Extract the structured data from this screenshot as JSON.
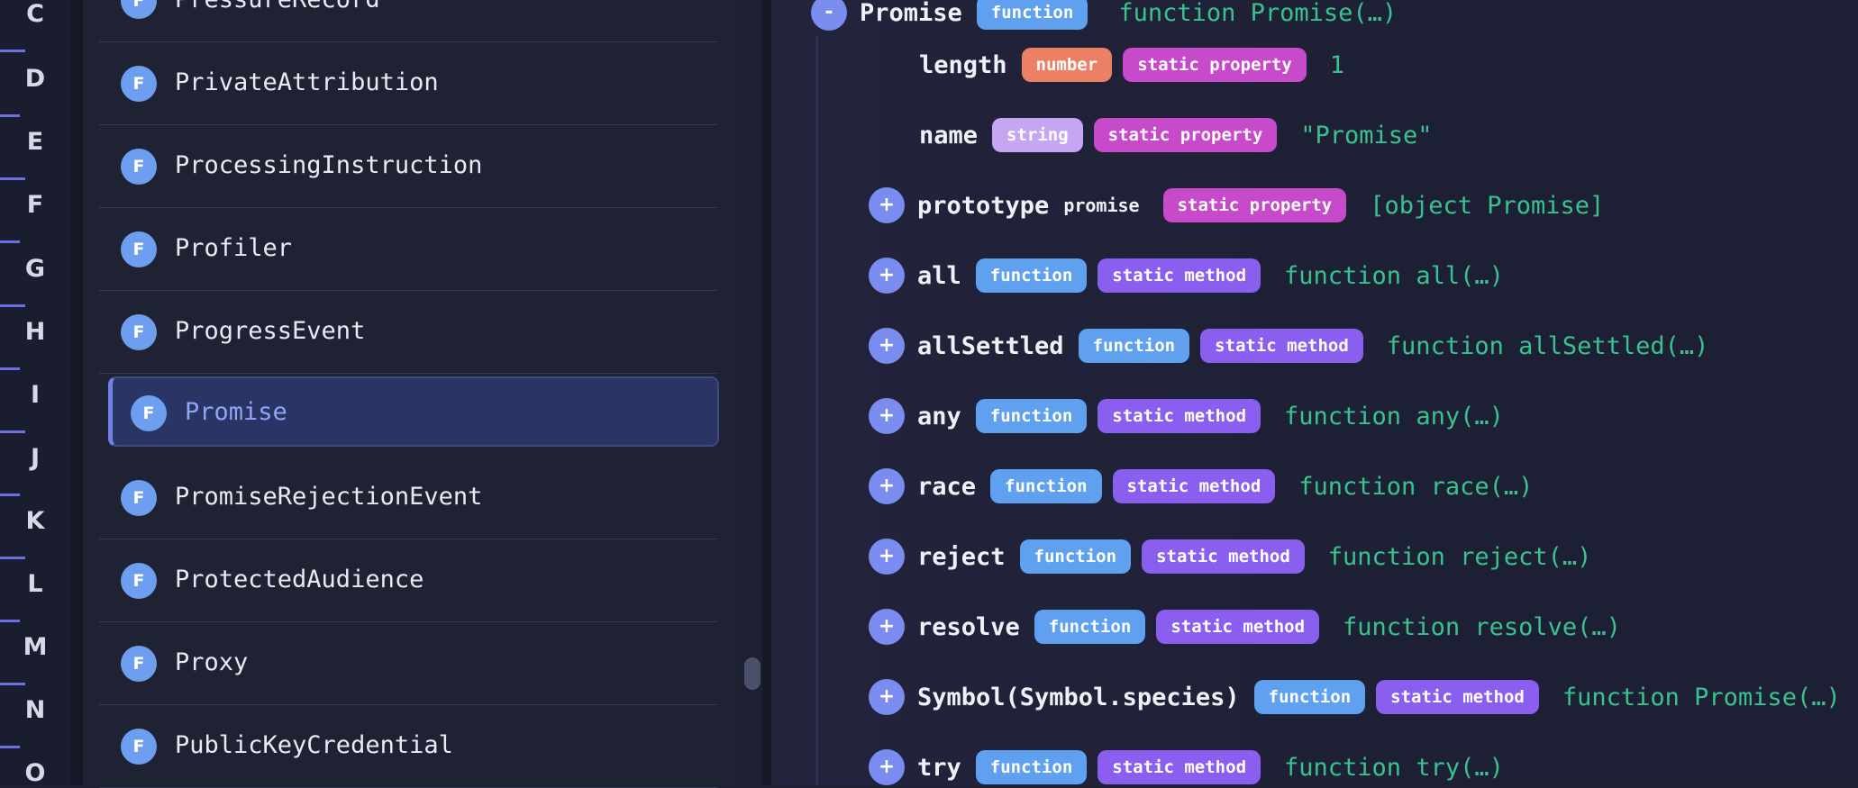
{
  "alphabet": [
    "C",
    "D",
    "E",
    "F",
    "G",
    "H",
    "I",
    "J",
    "K",
    "L",
    "M",
    "N",
    "O"
  ],
  "list": {
    "badge": "F",
    "items": [
      "PressureRecord",
      "PrivateAttribution",
      "ProcessingInstruction",
      "Profiler",
      "ProgressEvent",
      "Promise",
      "PromiseRejectionEvent",
      "ProtectedAudience",
      "Proxy",
      "PublicKeyCredential"
    ],
    "selected": "Promise"
  },
  "details": {
    "root": {
      "expand_glyph": "-",
      "name": "Promise",
      "type": "function",
      "value": "function Promise(…)"
    },
    "expand_glyph": "+",
    "props": [
      {
        "name": "length",
        "type": "number",
        "kind": "static property",
        "value": "1",
        "expandable": false
      },
      {
        "name": "name",
        "type": "string",
        "kind": "static property",
        "value": "\"Promise\"",
        "expandable": false
      },
      {
        "name": "prototype",
        "type": "promise",
        "kind": "static property",
        "value": "[object Promise]",
        "expandable": true
      },
      {
        "name": "all",
        "type": "function",
        "kind": "static method",
        "value": "function all(…)",
        "expandable": true
      },
      {
        "name": "allSettled",
        "type": "function",
        "kind": "static method",
        "value": "function allSettled(…)",
        "expandable": true
      },
      {
        "name": "any",
        "type": "function",
        "kind": "static method",
        "value": "function any(…)",
        "expandable": true
      },
      {
        "name": "race",
        "type": "function",
        "kind": "static method",
        "value": "function race(…)",
        "expandable": true
      },
      {
        "name": "reject",
        "type": "function",
        "kind": "static method",
        "value": "function reject(…)",
        "expandable": true
      },
      {
        "name": "resolve",
        "type": "function",
        "kind": "static method",
        "value": "function resolve(…)",
        "expandable": true
      },
      {
        "name": "Symbol(Symbol.species)",
        "type": "function",
        "kind": "static method",
        "value": "function Promise(…)",
        "expandable": true
      },
      {
        "name": "try",
        "type": "function",
        "kind": "static method",
        "value": "function try(…)",
        "expandable": true
      }
    ]
  },
  "colors": {
    "accent": "#7a8cf0",
    "value_green": "#39c28e",
    "selected_bg": "#2a3565"
  }
}
